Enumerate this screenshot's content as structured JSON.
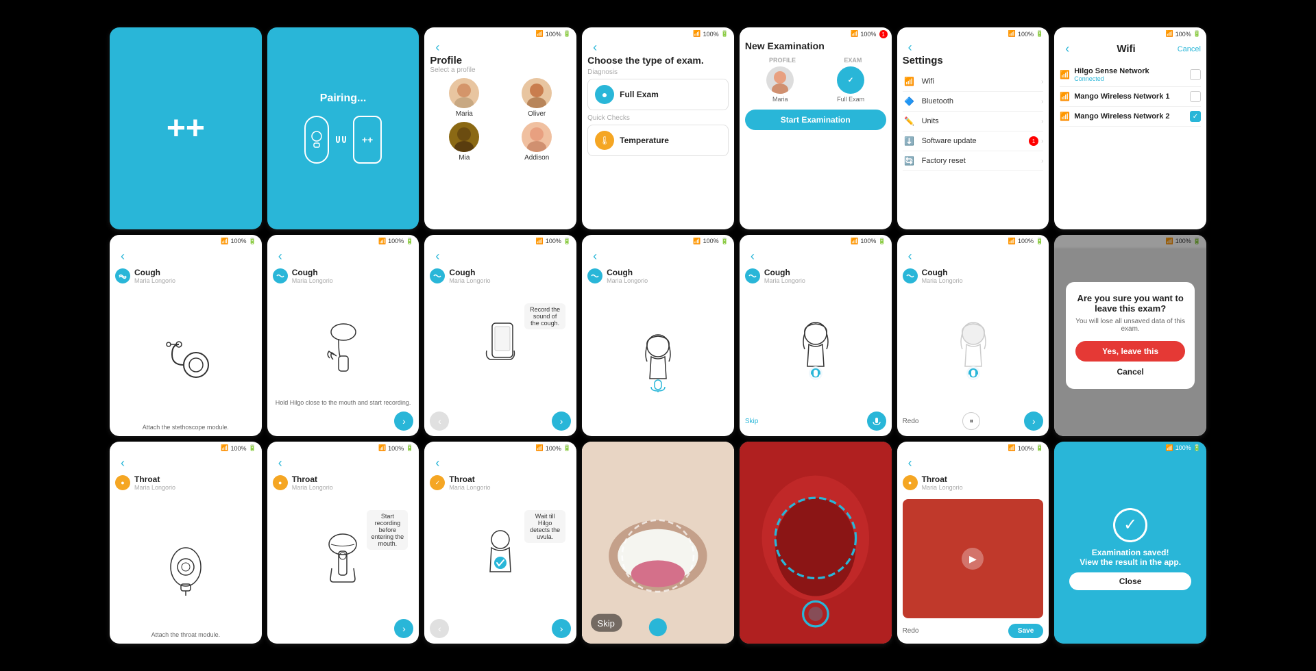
{
  "screens": {
    "row1": [
      {
        "id": "logo",
        "type": "logo",
        "logo_symbol": "++",
        "bg": "blue"
      },
      {
        "id": "pairing",
        "type": "pairing",
        "title": "Pairing...",
        "bg": "blue"
      },
      {
        "id": "profile",
        "type": "profile",
        "title": "Profile",
        "subtitle": "Select a profile",
        "profiles": [
          {
            "name": "Maria"
          },
          {
            "name": "Oliver"
          },
          {
            "name": "Mia"
          },
          {
            "name": "Addison"
          }
        ]
      },
      {
        "id": "exam_type",
        "type": "exam_type",
        "title": "Choose the type of exam.",
        "diagnosis_label": "Diagnosis",
        "quick_checks_label": "Quick Checks",
        "options": [
          {
            "label": "Full Exam",
            "icon": "blue"
          },
          {
            "label": "Temperature",
            "icon": "orange"
          }
        ]
      },
      {
        "id": "new_exam",
        "type": "new_exam",
        "title": "New Examination",
        "profile_col": "PROFILE",
        "exam_col": "EXAM",
        "patient": "Maria",
        "exam_type": "Full Exam",
        "start_label": "Start Examination",
        "has_notification": true
      },
      {
        "id": "settings",
        "type": "settings",
        "title": "Settings",
        "items": [
          {
            "icon": "wifi",
            "label": "Wifi"
          },
          {
            "icon": "bluetooth",
            "label": "Bluetooth"
          },
          {
            "icon": "units",
            "label": "Units"
          },
          {
            "icon": "update",
            "label": "Software update",
            "badge": "1"
          },
          {
            "icon": "factory",
            "label": "Factory reset"
          }
        ]
      },
      {
        "id": "wifi",
        "type": "wifi",
        "title": "Wifi",
        "cancel_label": "Cancel",
        "networks": [
          {
            "name": "Hilgo Sense Network",
            "status": "Connected",
            "checked": true
          },
          {
            "name": "Mango Wireless Network 1",
            "status": "",
            "checked": false
          },
          {
            "name": "Mango Wireless Network 2",
            "status": "",
            "checked": true
          }
        ]
      }
    ],
    "row2": [
      {
        "id": "cough1",
        "type": "cough_instruction",
        "exam_type": "Cough",
        "patient": "Maria Longorio",
        "caption": "Attach the stethoscope module.",
        "has_next": false
      },
      {
        "id": "cough2",
        "type": "cough_hold",
        "exam_type": "Cough",
        "patient": "Maria Longorio",
        "caption": "Hold Hilgo close to the mouth and start recording.",
        "has_next": true
      },
      {
        "id": "cough3",
        "type": "cough_record",
        "exam_type": "Cough",
        "patient": "Maria Longorio",
        "instruction": "Record the sound of the cough.",
        "has_prev": true,
        "has_next": true
      },
      {
        "id": "cough4",
        "type": "cough_mic",
        "exam_type": "Cough",
        "patient": "Maria Longorio",
        "state": "ready"
      },
      {
        "id": "cough5",
        "type": "cough_mic_active",
        "exam_type": "Cough",
        "patient": "Maria Longorio",
        "skip_label": "Skip"
      },
      {
        "id": "cough6",
        "type": "cough_redo",
        "exam_type": "Cough",
        "patient": "Maria Longorio",
        "redo_label": "Redo",
        "has_next": true
      },
      {
        "id": "leave_alert",
        "type": "alert",
        "title": "Are you sure you want to leave this exam?",
        "subtitle": "You will lose all unsaved data of this exam.",
        "confirm_label": "Yes, leave this",
        "cancel_label": "Cancel"
      }
    ],
    "row3": [
      {
        "id": "throat1",
        "type": "throat_attach",
        "exam_type": "Throat",
        "patient": "Maria Longorio",
        "caption": "Attach the throat module.",
        "icon_color": "orange"
      },
      {
        "id": "throat2",
        "type": "throat_record",
        "exam_type": "Throat",
        "patient": "Maria Longorio",
        "instruction": "Start recording before entering the mouth.",
        "has_next": true,
        "icon_color": "orange"
      },
      {
        "id": "throat3",
        "type": "throat_detect",
        "exam_type": "Throat",
        "patient": "Maria Longorio",
        "instruction": "Wait till Hilgo detects the uvula.",
        "has_prev": true,
        "has_next": true,
        "icon_color": "orange"
      },
      {
        "id": "throat_cam1",
        "type": "throat_camera",
        "skip_label": "Skip",
        "camera_stage": "mouth_open"
      },
      {
        "id": "throat_cam2",
        "type": "throat_camera2",
        "camera_stage": "throat_close"
      },
      {
        "id": "throat_video",
        "type": "throat_video_review",
        "exam_type": "Throat",
        "patient": "Maria Longorio",
        "redo_label": "Redo",
        "save_label": "Save",
        "icon_color": "orange"
      },
      {
        "id": "saved",
        "type": "saved",
        "title": "Examination saved! View the result in the app.",
        "close_label": "Close"
      }
    ]
  }
}
